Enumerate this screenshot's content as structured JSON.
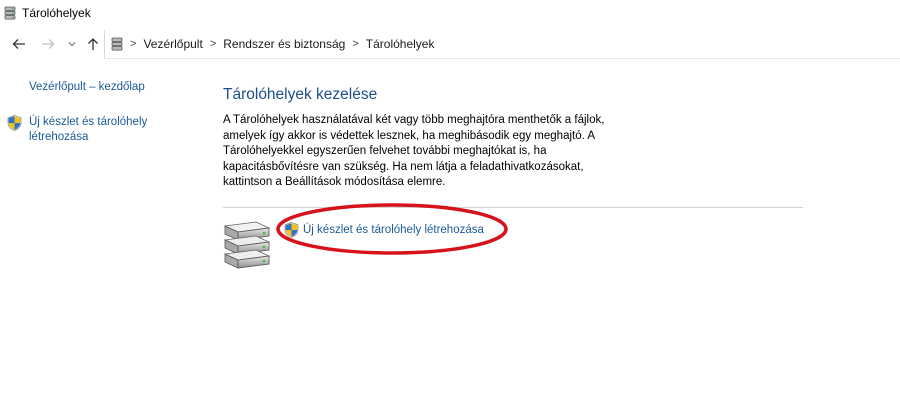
{
  "window": {
    "title": "Tárolóhelyek"
  },
  "nav": {
    "back_icon": "arrow-left-icon",
    "forward_icon": "arrow-right-icon",
    "recent_icon": "chevron-down-icon",
    "up_icon": "arrow-up-icon"
  },
  "breadcrumb": {
    "separator": ">",
    "items": [
      "Vezérlőpult",
      "Rendszer és biztonság",
      "Tárolóhelyek"
    ]
  },
  "sidebar": {
    "home_link": "Vezérlőpult – kezdőlap",
    "create_link": "Új készlet és tárolóhely létrehozása"
  },
  "main": {
    "heading": "Tárolóhelyek kezelése",
    "description": "A Tárolóhelyek használatával két vagy több meghajtóra menthetők a fájlok, amelyek így akkor is védettek lesznek, ha meghibásodik egy meghajtó. A Tárolóhelyekkel egyszerűen felvehet további meghajtókat is, ha kapacitásbővítésre van szükség. Ha nem látja a feladathivatkozásokat, kattintson a Beállítások módosítása elemre.",
    "create_link": "Új készlet és tárolóhely létrehozása"
  },
  "colors": {
    "link": "#1a5a96",
    "heading": "#1e4e8c",
    "annotation": "#d7131a"
  }
}
